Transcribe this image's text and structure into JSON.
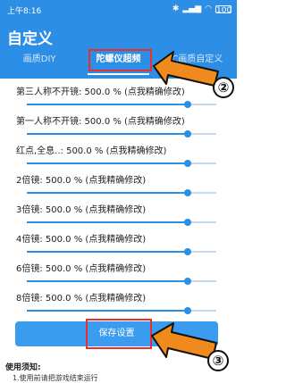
{
  "status": {
    "time": "上午8:16",
    "battery": "100"
  },
  "header": {
    "title": "自定义"
  },
  "tabs": [
    {
      "label": "画质DIY"
    },
    {
      "label": "陀螺仪超频"
    },
    {
      "label": "C画质自定义"
    }
  ],
  "settings": [
    {
      "label": "第三人称不开镜:  500.0 %  (点我精确修改)",
      "value_percent": 500.0,
      "fraction": 0.85
    },
    {
      "label": "第一人称不开镜:  500.0 %  (点我精确修改)",
      "value_percent": 500.0,
      "fraction": 0.85
    },
    {
      "label": "红点,全息..:  500.0 %  (点我精确修改)",
      "value_percent": 500.0,
      "fraction": 0.85
    },
    {
      "label": "2倍镜:  500.0 %  (点我精确修改)",
      "value_percent": 500.0,
      "fraction": 0.85
    },
    {
      "label": "3倍镜:  500.0 %  (点我精确修改)",
      "value_percent": 500.0,
      "fraction": 0.85
    },
    {
      "label": "4倍镜:  500.0 %  (点我精确修改)",
      "value_percent": 500.0,
      "fraction": 0.85
    },
    {
      "label": "6倍镜:  500.0 %  (点我精确修改)",
      "value_percent": 500.0,
      "fraction": 0.85
    },
    {
      "label": "8倍镜:  500.0 %  (点我精确修改)",
      "value_percent": 500.0,
      "fraction": 0.85
    }
  ],
  "save_button": {
    "label": "保存设置"
  },
  "notice": {
    "title": "使用须知:",
    "line1": "1.使用前请把游戏结束运行"
  },
  "annotations": [
    {
      "label": "②"
    },
    {
      "label": "③"
    }
  ],
  "colors": {
    "primary": "#2d8ee6",
    "highlight": "#e53030",
    "arrow": "#f08a1c"
  }
}
